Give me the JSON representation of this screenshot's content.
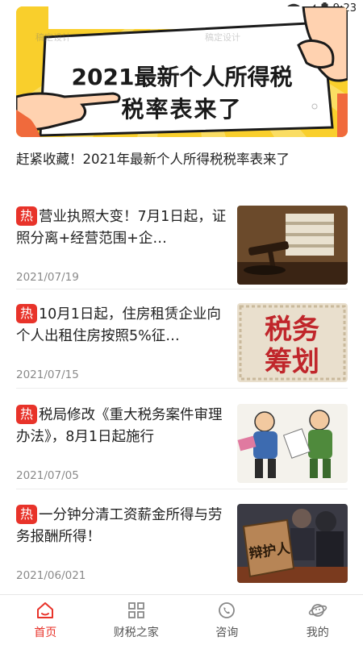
{
  "status": {
    "time": "9:23"
  },
  "banner": {
    "line1": "2021最新个人所得税",
    "line2": "税率表来了",
    "watermark_left": "稿定设计",
    "watermark_right": "稿定设计"
  },
  "headline": "赶紧收藏！2021年最新个人所得税税率表来了",
  "hot_label": "热",
  "articles": [
    {
      "title": "营业执照大变！7月1日起，证照分离+经营范围+企…",
      "date": "2021/07/19"
    },
    {
      "title": "10月1日起，住房租赁企业向个人出租住房按照5%征…",
      "date": "2021/07/15"
    },
    {
      "title": "税局修改《重大税务案件审理办法》，8月1日起施行",
      "date": "2021/07/05"
    },
    {
      "title": "一分钟分清工资薪金所得与劳务报酬所得！",
      "date": "2021/06/021"
    }
  ],
  "thumb2_text": {
    "top": "税务",
    "bottom": "筹划"
  },
  "thumb4_text": "辩护人",
  "tabs": [
    {
      "label": "首页",
      "icon": "home-icon",
      "active": true
    },
    {
      "label": "财税之家",
      "icon": "grid-icon",
      "active": false
    },
    {
      "label": "咨询",
      "icon": "phone-chat-icon",
      "active": false
    },
    {
      "label": "我的",
      "icon": "planet-icon",
      "active": false
    }
  ],
  "colors": {
    "accent": "#e8332a",
    "banner_yellow": "#f7c51e"
  }
}
